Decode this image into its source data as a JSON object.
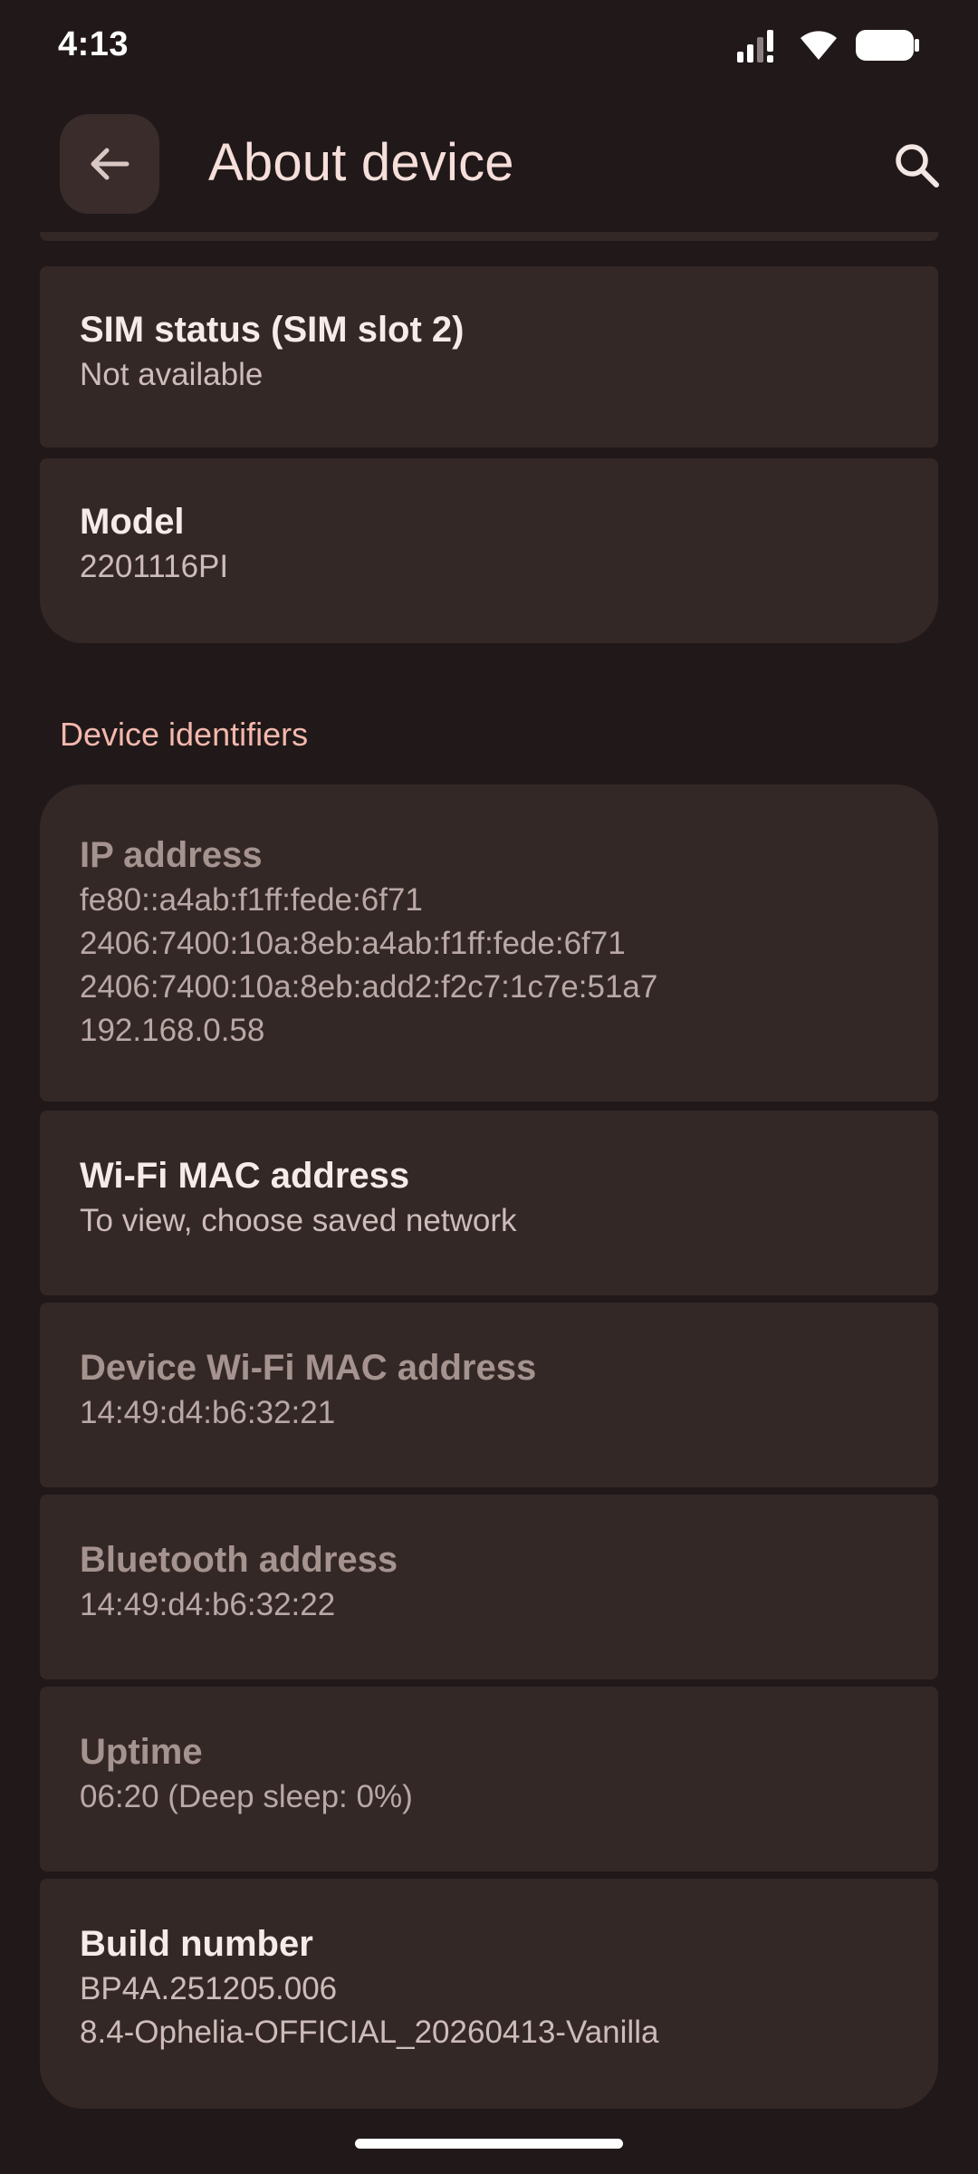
{
  "status_bar": {
    "time": "4:13",
    "icons": [
      "signal-icon",
      "wifi-icon",
      "battery-icon"
    ]
  },
  "app_bar": {
    "title": "About device",
    "back_icon": "back-arrow-icon",
    "search_icon": "search-icon"
  },
  "items_top": [
    {
      "title": "SIM status (SIM slot 2)",
      "subtitle": "Not available"
    },
    {
      "title": "Model",
      "subtitle": "2201116PI"
    }
  ],
  "section": {
    "header": "Device identifiers"
  },
  "ip_address": {
    "title": "IP address",
    "lines": [
      "fe80::a4ab:f1ff:fede:6f71",
      "2406:7400:10a:8eb:a4ab:f1ff:fede:6f71",
      "2406:7400:10a:8eb:add2:f2c7:1c7e:51a7",
      "192.168.0.58"
    ]
  },
  "identifiers": [
    {
      "title": "Wi-Fi MAC address",
      "subtitle": "To view, choose saved network"
    },
    {
      "title": "Device Wi-Fi MAC address",
      "subtitle": "14:49:d4:b6:32:21"
    },
    {
      "title": "Bluetooth address",
      "subtitle": "14:49:d4:b6:32:22"
    },
    {
      "title": "Uptime",
      "subtitle": "06:20 (Deep sleep: 0%)"
    }
  ],
  "build": {
    "title": "Build number",
    "lines": [
      "BP4A.251205.006",
      "8.4-Ophelia-OFFICIAL_20260413-Vanilla"
    ]
  },
  "colors": {
    "background": "#211919",
    "card": "#342827",
    "accent": "#f4b8ad"
  }
}
